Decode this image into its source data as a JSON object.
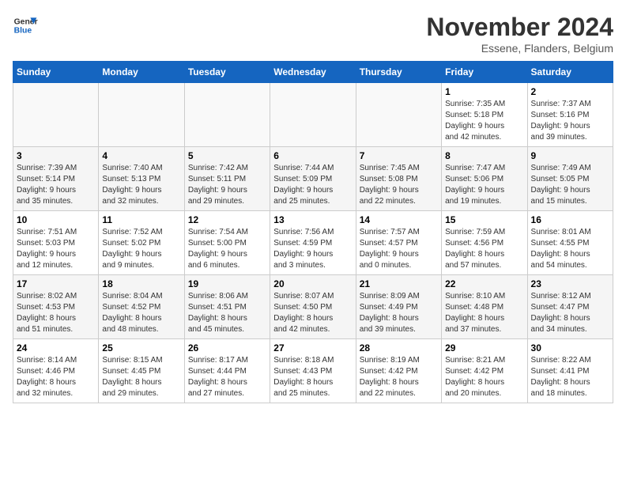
{
  "header": {
    "logo_line1": "General",
    "logo_line2": "Blue",
    "month_year": "November 2024",
    "location": "Essene, Flanders, Belgium"
  },
  "weekdays": [
    "Sunday",
    "Monday",
    "Tuesday",
    "Wednesday",
    "Thursday",
    "Friday",
    "Saturday"
  ],
  "weeks": [
    [
      {
        "day": "",
        "info": ""
      },
      {
        "day": "",
        "info": ""
      },
      {
        "day": "",
        "info": ""
      },
      {
        "day": "",
        "info": ""
      },
      {
        "day": "",
        "info": ""
      },
      {
        "day": "1",
        "info": "Sunrise: 7:35 AM\nSunset: 5:18 PM\nDaylight: 9 hours\nand 42 minutes."
      },
      {
        "day": "2",
        "info": "Sunrise: 7:37 AM\nSunset: 5:16 PM\nDaylight: 9 hours\nand 39 minutes."
      }
    ],
    [
      {
        "day": "3",
        "info": "Sunrise: 7:39 AM\nSunset: 5:14 PM\nDaylight: 9 hours\nand 35 minutes."
      },
      {
        "day": "4",
        "info": "Sunrise: 7:40 AM\nSunset: 5:13 PM\nDaylight: 9 hours\nand 32 minutes."
      },
      {
        "day": "5",
        "info": "Sunrise: 7:42 AM\nSunset: 5:11 PM\nDaylight: 9 hours\nand 29 minutes."
      },
      {
        "day": "6",
        "info": "Sunrise: 7:44 AM\nSunset: 5:09 PM\nDaylight: 9 hours\nand 25 minutes."
      },
      {
        "day": "7",
        "info": "Sunrise: 7:45 AM\nSunset: 5:08 PM\nDaylight: 9 hours\nand 22 minutes."
      },
      {
        "day": "8",
        "info": "Sunrise: 7:47 AM\nSunset: 5:06 PM\nDaylight: 9 hours\nand 19 minutes."
      },
      {
        "day": "9",
        "info": "Sunrise: 7:49 AM\nSunset: 5:05 PM\nDaylight: 9 hours\nand 15 minutes."
      }
    ],
    [
      {
        "day": "10",
        "info": "Sunrise: 7:51 AM\nSunset: 5:03 PM\nDaylight: 9 hours\nand 12 minutes."
      },
      {
        "day": "11",
        "info": "Sunrise: 7:52 AM\nSunset: 5:02 PM\nDaylight: 9 hours\nand 9 minutes."
      },
      {
        "day": "12",
        "info": "Sunrise: 7:54 AM\nSunset: 5:00 PM\nDaylight: 9 hours\nand 6 minutes."
      },
      {
        "day": "13",
        "info": "Sunrise: 7:56 AM\nSunset: 4:59 PM\nDaylight: 9 hours\nand 3 minutes."
      },
      {
        "day": "14",
        "info": "Sunrise: 7:57 AM\nSunset: 4:57 PM\nDaylight: 9 hours\nand 0 minutes."
      },
      {
        "day": "15",
        "info": "Sunrise: 7:59 AM\nSunset: 4:56 PM\nDaylight: 8 hours\nand 57 minutes."
      },
      {
        "day": "16",
        "info": "Sunrise: 8:01 AM\nSunset: 4:55 PM\nDaylight: 8 hours\nand 54 minutes."
      }
    ],
    [
      {
        "day": "17",
        "info": "Sunrise: 8:02 AM\nSunset: 4:53 PM\nDaylight: 8 hours\nand 51 minutes."
      },
      {
        "day": "18",
        "info": "Sunrise: 8:04 AM\nSunset: 4:52 PM\nDaylight: 8 hours\nand 48 minutes."
      },
      {
        "day": "19",
        "info": "Sunrise: 8:06 AM\nSunset: 4:51 PM\nDaylight: 8 hours\nand 45 minutes."
      },
      {
        "day": "20",
        "info": "Sunrise: 8:07 AM\nSunset: 4:50 PM\nDaylight: 8 hours\nand 42 minutes."
      },
      {
        "day": "21",
        "info": "Sunrise: 8:09 AM\nSunset: 4:49 PM\nDaylight: 8 hours\nand 39 minutes."
      },
      {
        "day": "22",
        "info": "Sunrise: 8:10 AM\nSunset: 4:48 PM\nDaylight: 8 hours\nand 37 minutes."
      },
      {
        "day": "23",
        "info": "Sunrise: 8:12 AM\nSunset: 4:47 PM\nDaylight: 8 hours\nand 34 minutes."
      }
    ],
    [
      {
        "day": "24",
        "info": "Sunrise: 8:14 AM\nSunset: 4:46 PM\nDaylight: 8 hours\nand 32 minutes."
      },
      {
        "day": "25",
        "info": "Sunrise: 8:15 AM\nSunset: 4:45 PM\nDaylight: 8 hours\nand 29 minutes."
      },
      {
        "day": "26",
        "info": "Sunrise: 8:17 AM\nSunset: 4:44 PM\nDaylight: 8 hours\nand 27 minutes."
      },
      {
        "day": "27",
        "info": "Sunrise: 8:18 AM\nSunset: 4:43 PM\nDaylight: 8 hours\nand 25 minutes."
      },
      {
        "day": "28",
        "info": "Sunrise: 8:19 AM\nSunset: 4:42 PM\nDaylight: 8 hours\nand 22 minutes."
      },
      {
        "day": "29",
        "info": "Sunrise: 8:21 AM\nSunset: 4:42 PM\nDaylight: 8 hours\nand 20 minutes."
      },
      {
        "day": "30",
        "info": "Sunrise: 8:22 AM\nSunset: 4:41 PM\nDaylight: 8 hours\nand 18 minutes."
      }
    ]
  ]
}
